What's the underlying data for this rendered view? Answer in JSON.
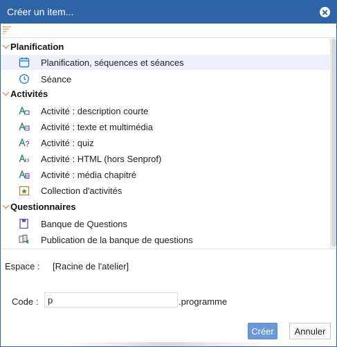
{
  "dialog": {
    "title": "Créer un item...",
    "close_icon": "close-icon",
    "sort_icon": "sort-icon"
  },
  "colors": {
    "titlebar": "#2f64a7",
    "accent": "#6b9ad6",
    "chevron": "#c87a1f",
    "activity_icon": "#3a8a5a",
    "selection": "#eef1f9"
  },
  "tree": {
    "groups": [
      {
        "label": "Planification",
        "items": [
          {
            "label": "Planification, séquences et séances",
            "icon": "calendar-icon",
            "selected": true
          },
          {
            "label": "Séance",
            "icon": "clock-icon",
            "selected": false
          }
        ]
      },
      {
        "label": "Activités",
        "items": [
          {
            "label": "Activité : description courte",
            "icon": "activity-short-icon",
            "selected": false
          },
          {
            "label": "Activité : texte et multimédia",
            "icon": "activity-multimedia-icon",
            "selected": false
          },
          {
            "label": "Activité : quiz",
            "icon": "activity-quiz-icon",
            "selected": false
          },
          {
            "label": "Activité : HTML (hors Senprof)",
            "icon": "activity-html-icon",
            "selected": false
          },
          {
            "label": "Activité : média chapitré",
            "icon": "activity-media-icon",
            "selected": false
          },
          {
            "label": "Collection d'activités",
            "icon": "collection-icon",
            "selected": false
          }
        ]
      },
      {
        "label": "Questionnaires",
        "items": [
          {
            "label": "Banque de Questions",
            "icon": "question-bank-icon",
            "selected": false
          },
          {
            "label": "Publication de la banque de questions",
            "icon": "publication-icon",
            "selected": false
          }
        ]
      }
    ]
  },
  "space": {
    "label": "Espace :",
    "value": "[Racine de l'atelier]"
  },
  "code": {
    "label": "Code :",
    "value": "p",
    "suffix": ".programme"
  },
  "buttons": {
    "create": "Créer",
    "cancel": "Annuler"
  }
}
